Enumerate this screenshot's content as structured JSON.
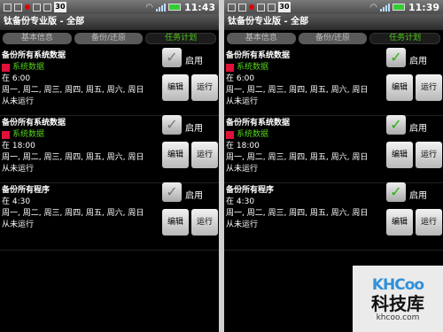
{
  "screens": [
    {
      "time": "11:43",
      "title": "钛备份专业版 - 全部",
      "badge": "30",
      "tabs": [
        "基本信息",
        "备份/还原",
        "任务计划"
      ],
      "tasks": [
        {
          "name": "备份所有系统数据",
          "dataset": "系统数据",
          "time": "在 6:00",
          "days": "周一, 周二, 周三, 周四, 周五, 周六, 周日",
          "last": "从未运行",
          "enabled": false,
          "enable_label": "启用",
          "edit_label": "编辑",
          "run_label": "运行"
        },
        {
          "name": "备份所有系统数据",
          "dataset": "系统数据",
          "time": "在 18:00",
          "days": "周一, 周二, 周三, 周四, 周五, 周六, 周日",
          "last": "从未运行",
          "enabled": false,
          "enable_label": "启用",
          "edit_label": "编辑",
          "run_label": "运行"
        },
        {
          "name": "备份所有程序",
          "dataset": "",
          "time": "在 4:30",
          "days": "周一, 周二, 周三, 周四, 周五, 周六, 周日",
          "last": "从未运行",
          "enabled": false,
          "enable_label": "启用",
          "edit_label": "编辑",
          "run_label": "运行"
        }
      ]
    },
    {
      "time": "11:39",
      "title": "钛备份专业版 - 全部",
      "badge": "30",
      "tabs": [
        "基本信息",
        "备份/还原",
        "任务计划"
      ],
      "tasks": [
        {
          "name": "备份所有系统数据",
          "dataset": "系统数据",
          "time": "在 6:00",
          "days": "周一, 周二, 周三, 周四, 周五, 周六, 周日",
          "last": "从未运行",
          "enabled": true,
          "enable_label": "启用",
          "edit_label": "编辑",
          "run_label": "运行"
        },
        {
          "name": "备份所有系统数据",
          "dataset": "系统数据",
          "time": "在 18:00",
          "days": "周一, 周二, 周三, 周四, 周五, 周六, 周日",
          "last": "从未运行",
          "enabled": true,
          "enable_label": "启用",
          "edit_label": "编辑",
          "run_label": "运行"
        },
        {
          "name": "备份所有程序",
          "dataset": "",
          "time": "在 4:30",
          "days": "周一, 周二, 周三, 周四, 周五, 周六, 周日",
          "last": "从未运行",
          "enabled": true,
          "enable_label": "启用",
          "edit_label": "编辑",
          "run_label": "运行"
        }
      ]
    }
  ],
  "watermark": {
    "logo": "KHCoo",
    "cn": "科技库",
    "url": "khcoo.com"
  },
  "colors": {
    "active_tab": "#4fc814",
    "dataset_text": "#56d01e",
    "dataset_marker": "#e0103a",
    "check_on": "#28b010"
  }
}
